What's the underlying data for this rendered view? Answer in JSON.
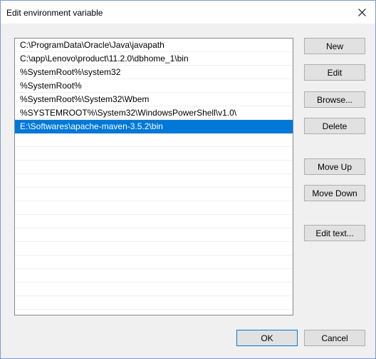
{
  "window": {
    "title": "Edit environment variable",
    "close_icon": "close-icon"
  },
  "list": {
    "items": [
      {
        "label": "C:\\ProgramData\\Oracle\\Java\\javapath",
        "selected": false
      },
      {
        "label": "C:\\app\\Lenovo\\product\\11.2.0\\dbhome_1\\bin",
        "selected": false
      },
      {
        "label": "%SystemRoot%\\system32",
        "selected": false
      },
      {
        "label": "%SystemRoot%",
        "selected": false
      },
      {
        "label": "%SystemRoot%\\System32\\Wbem",
        "selected": false
      },
      {
        "label": "%SYSTEMROOT%\\System32\\WindowsPowerShell\\v1.0\\",
        "selected": false
      },
      {
        "label": "E:\\Softwares\\apache-maven-3.5.2\\bin",
        "selected": true
      }
    ],
    "selected_color": "#0078d7"
  },
  "buttons": {
    "new": "New",
    "edit": "Edit",
    "browse": "Browse...",
    "delete": "Delete",
    "move_up": "Move Up",
    "move_down": "Move Down",
    "edit_text": "Edit text...",
    "ok": "OK",
    "cancel": "Cancel"
  }
}
